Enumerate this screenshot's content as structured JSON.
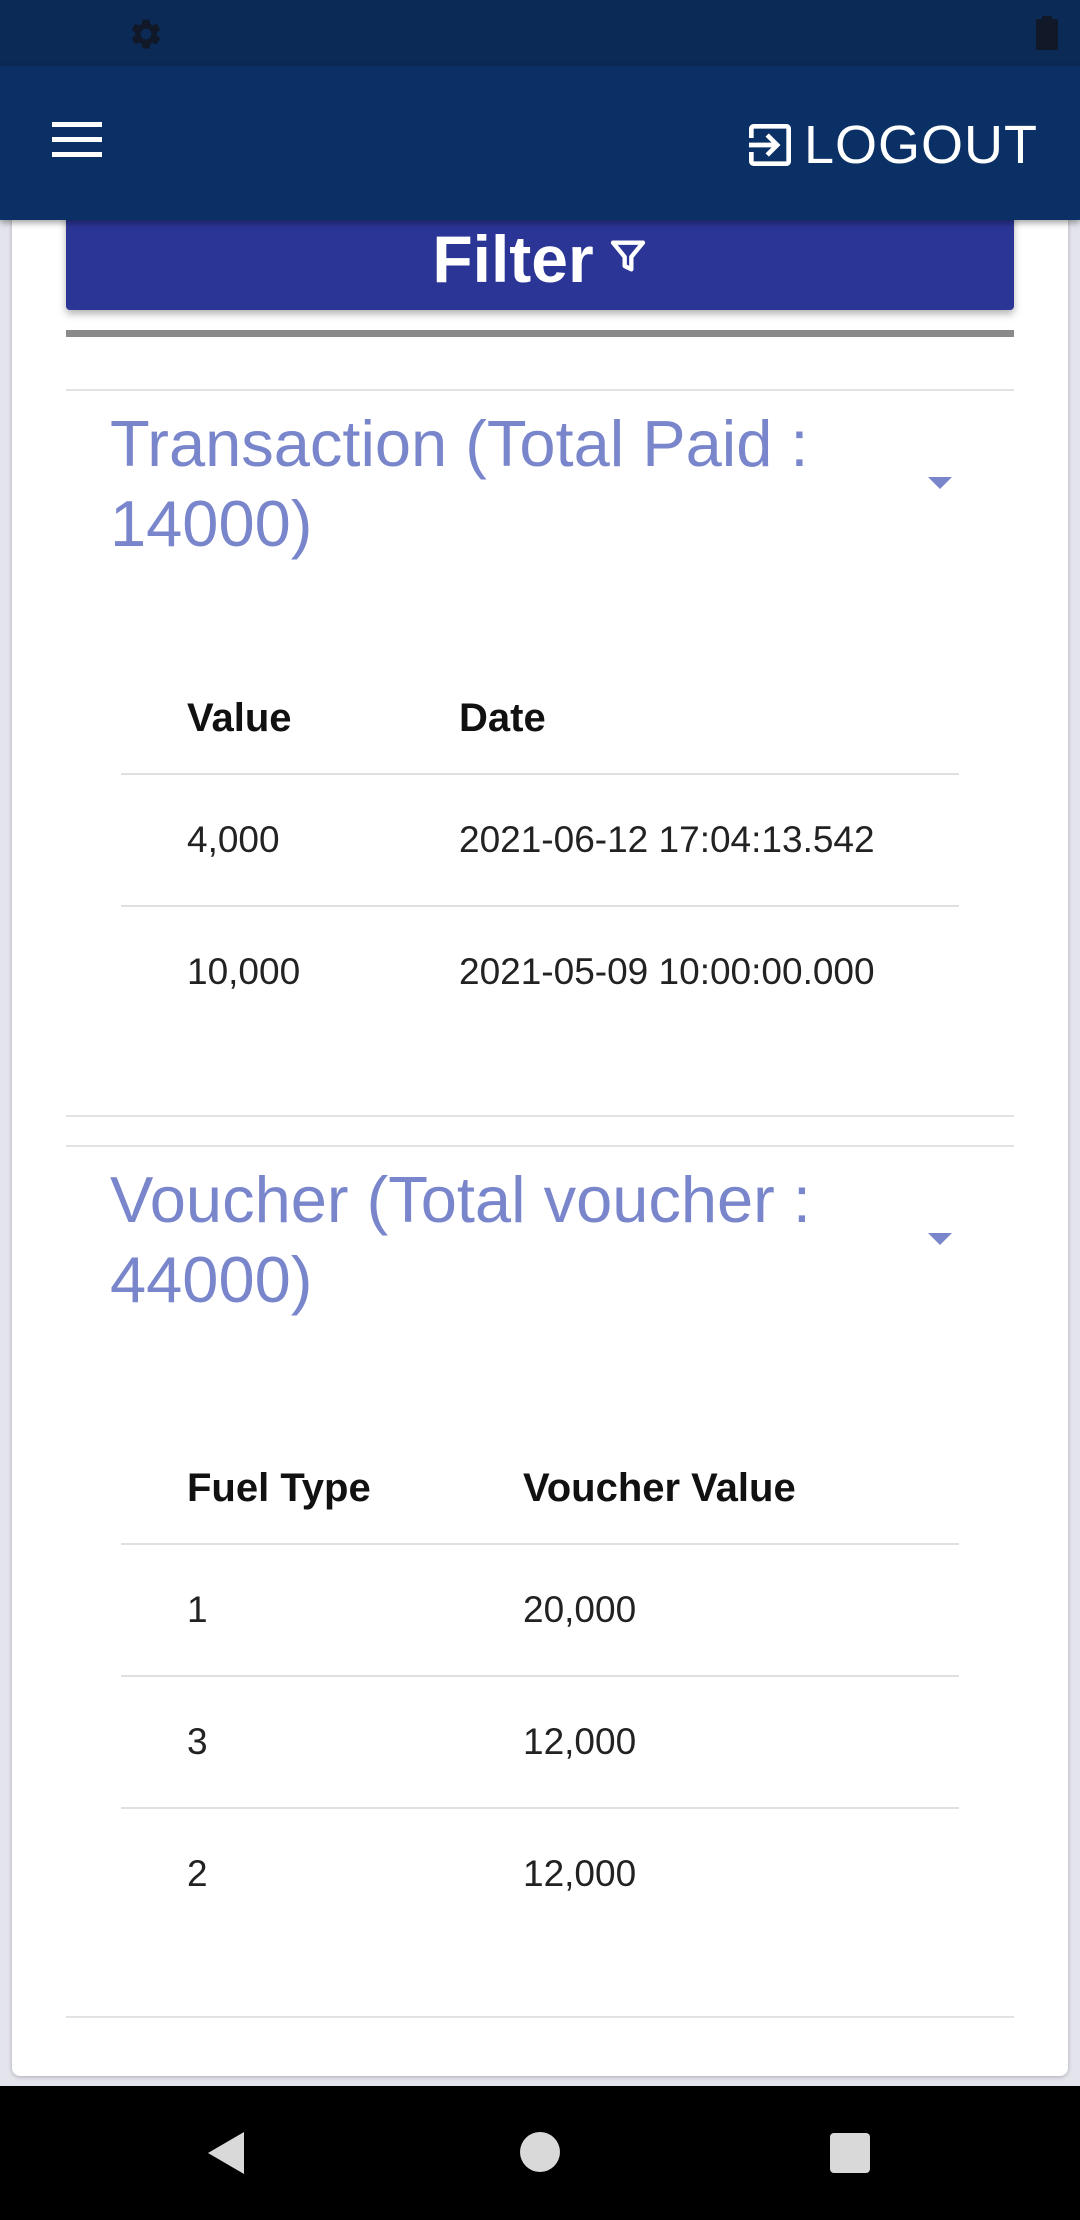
{
  "status_bar": {
    "left_icon": "gear-icon",
    "right_icon": "battery-icon"
  },
  "app_bar": {
    "menu_icon": "hamburger-menu-icon",
    "logout_icon": "logout-icon",
    "logout_label": "LOGOUT",
    "background": "#0a3066"
  },
  "filter": {
    "label": "Filter",
    "icon": "filter-funnel-icon",
    "background": "#2b3596"
  },
  "transactions": {
    "title": "Transaction (Total Paid : 14000)",
    "accent": "#7986cb",
    "columns": [
      "Value",
      "Date"
    ],
    "rows": [
      [
        "4,000",
        "2021-06-12 17:04:13.542"
      ],
      [
        "10,000",
        "2021-05-09 10:00:00.000"
      ]
    ]
  },
  "vouchers": {
    "title": "Voucher (Total voucher : 44000)",
    "columns": [
      "Fuel Type",
      "Voucher Value"
    ],
    "rows": [
      [
        "1",
        "20,000"
      ],
      [
        "3",
        "12,000"
      ],
      [
        "2",
        "12,000"
      ]
    ]
  },
  "nav_bar": {
    "back_icon": "back-triangle-icon",
    "home_icon": "home-circle-icon",
    "recent_icon": "recent-apps-square-icon"
  }
}
